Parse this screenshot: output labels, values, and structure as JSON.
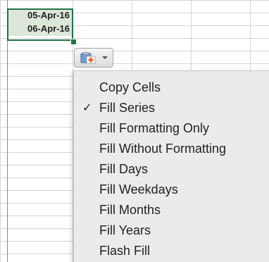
{
  "cells": {
    "a1": "05-Apr-16",
    "a2": "06-Apr-16"
  },
  "autofill_options": {
    "paste_icon": "clipboard-icon",
    "dropdown_icon": "chevron-down-icon"
  },
  "menu": {
    "checkmark": "✓",
    "items": [
      {
        "label": "Copy Cells",
        "checked": false
      },
      {
        "label": "Fill Series",
        "checked": true
      },
      {
        "label": "Fill Formatting Only",
        "checked": false
      },
      {
        "label": "Fill Without Formatting",
        "checked": false
      },
      {
        "label": "Fill Days",
        "checked": false
      },
      {
        "label": "Fill Weekdays",
        "checked": false
      },
      {
        "label": "Fill Months",
        "checked": false
      },
      {
        "label": "Fill Years",
        "checked": false
      },
      {
        "label": "Flash Fill",
        "checked": false
      }
    ]
  },
  "colors": {
    "selection_border": "#217346",
    "selected_fill": "#dde7d9",
    "menu_background": "#ebebeb",
    "paste_icon_accent": "#e8652a"
  }
}
